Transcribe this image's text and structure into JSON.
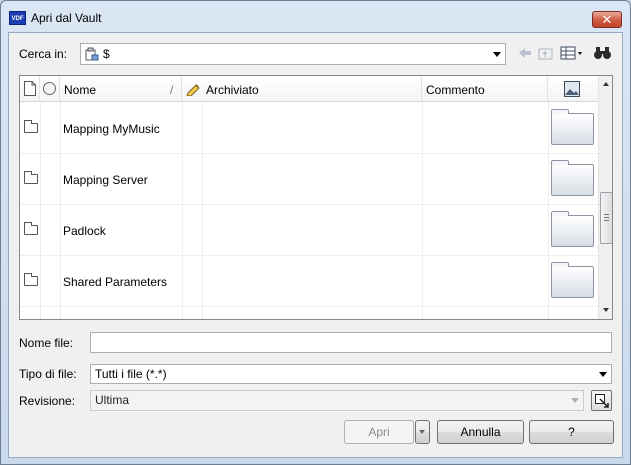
{
  "window": {
    "title": "Apri dal Vault",
    "app_badge": "VDF",
    "close_label": "✕"
  },
  "look_in": {
    "label": "Cerca in:",
    "value": "$"
  },
  "toolbar": {
    "icons": [
      "back-icon",
      "up-folder-icon",
      "view-menu-icon",
      "find-binoculars-icon"
    ]
  },
  "file_list": {
    "columns": [
      "Nome",
      "Archiviato",
      "Commento"
    ],
    "sort_indicator": "/",
    "rows": [
      {
        "name": "Mapping MyMusic"
      },
      {
        "name": "Mapping Server"
      },
      {
        "name": "Padlock"
      },
      {
        "name": "Shared Parameters"
      }
    ]
  },
  "file_name": {
    "label": "Nome file:",
    "value": ""
  },
  "file_type": {
    "label": "Tipo di file:",
    "value": "Tutti i file (*.*)"
  },
  "revision": {
    "label": "Revisione:",
    "value": "Ultima"
  },
  "buttons": {
    "open": "Apri",
    "cancel": "Annulla",
    "help": "?"
  }
}
